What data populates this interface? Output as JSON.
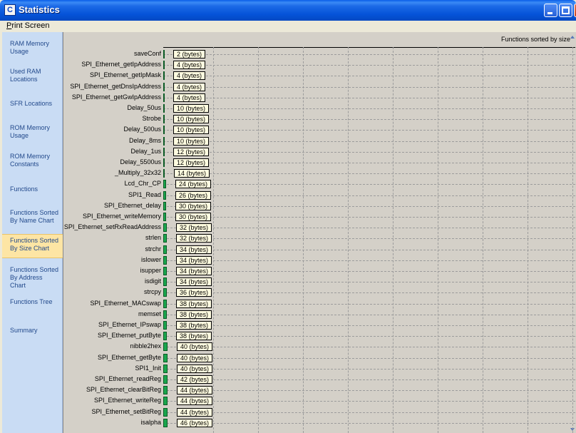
{
  "window": {
    "title": "Statistics",
    "icon": "app-c-icon"
  },
  "menu": {
    "print_screen": "Print Screen"
  },
  "sidebar": {
    "items": [
      {
        "label": "RAM Memory\nUsage",
        "active": false
      },
      {
        "label": "Used RAM\nLocations",
        "active": false
      },
      {
        "label": "SFR Locations",
        "active": false
      },
      {
        "label": "ROM Memory\nUsage",
        "active": false
      },
      {
        "label": "ROM Memory\nConstants",
        "active": false
      },
      {
        "label": "Functions",
        "active": false
      },
      {
        "label": "Functions Sorted\nBy Name Chart",
        "active": false
      },
      {
        "label": "Functions Sorted\nBy Size Chart",
        "active": true
      },
      {
        "label": "Functions Sorted\nBy Address Chart",
        "active": false
      },
      {
        "label": "Functions Tree",
        "active": false
      },
      {
        "label": "Summary",
        "active": false
      }
    ]
  },
  "chart_header": {
    "title": "Functions sorted by size"
  },
  "chart_data": {
    "type": "bar",
    "title": "Functions sorted by size",
    "unit": "bytes",
    "label_format": "{value} (bytes)",
    "bar_color": "#1aa64d",
    "categories": [
      "saveConf",
      "SPI_Ethernet_getIpAddress",
      "SPI_Ethernet_getIpMask",
      "SPI_Ethernet_getDnsIpAddress",
      "SPI_Ethernet_getGwIpAddress",
      "Delay_50us",
      "Strobe",
      "Delay_500us",
      "Delay_8ms",
      "Delay_1us",
      "Delay_5500us",
      "_Multiply_32x32",
      "Lcd_Chr_CP",
      "SPI1_Read",
      "SPI_Ethernet_delay",
      "SPI_Ethernet_writeMemory",
      "SPI_Ethernet_setRxReadAddress",
      "strlen",
      "strchr",
      "islower",
      "isupper",
      "isdigit",
      "strcpy",
      "SPI_Ethernet_MACswap",
      "memset",
      "SPI_Ethernet_IPswap",
      "SPI_Ethernet_putByte",
      "nibble2hex",
      "SPI_Ethernet_getByte",
      "SPI1_Init",
      "SPI_Ethernet_readReg",
      "SPI_Ethernet_clearBitReg",
      "SPI_Ethernet_writeReg",
      "SPI_Ethernet_setBitReg",
      "isalpha"
    ],
    "values": [
      2,
      4,
      4,
      4,
      4,
      10,
      10,
      10,
      10,
      12,
      12,
      14,
      24,
      26,
      30,
      30,
      32,
      32,
      34,
      34,
      34,
      34,
      36,
      38,
      38,
      38,
      38,
      40,
      40,
      40,
      42,
      44,
      44,
      44,
      46
    ]
  }
}
